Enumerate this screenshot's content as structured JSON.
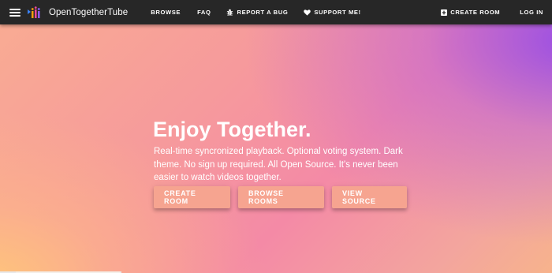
{
  "navbar": {
    "brand": "OpenTogetherTube",
    "browse": "Browse",
    "faq": "FAQ",
    "report_bug": "Report a bug",
    "support": "Support Me!",
    "create_room": "Create Room",
    "login": "Log in",
    "icons": {
      "menu": "hamburger-menu-icon",
      "logo": "opentogethertube-logo",
      "bug": "bug-icon",
      "heart": "heart-icon",
      "plus": "plus-box-icon"
    }
  },
  "hero": {
    "title": "Enjoy Together.",
    "description": "Real-time syncronized playback. Optional voting system. Dark theme. No sign up required. All Open Source. It's never been easier to watch videos together.",
    "buttons": {
      "create_room": "Create Room",
      "browse_rooms": "Browse Rooms",
      "view_source": "View Source"
    }
  },
  "colors": {
    "navbar_bg": "#272727",
    "button_bg": "#f6a490",
    "gradient_purple": "#9449e8",
    "gradient_pink": "#f48aa6",
    "gradient_peach": "#ffc878"
  }
}
